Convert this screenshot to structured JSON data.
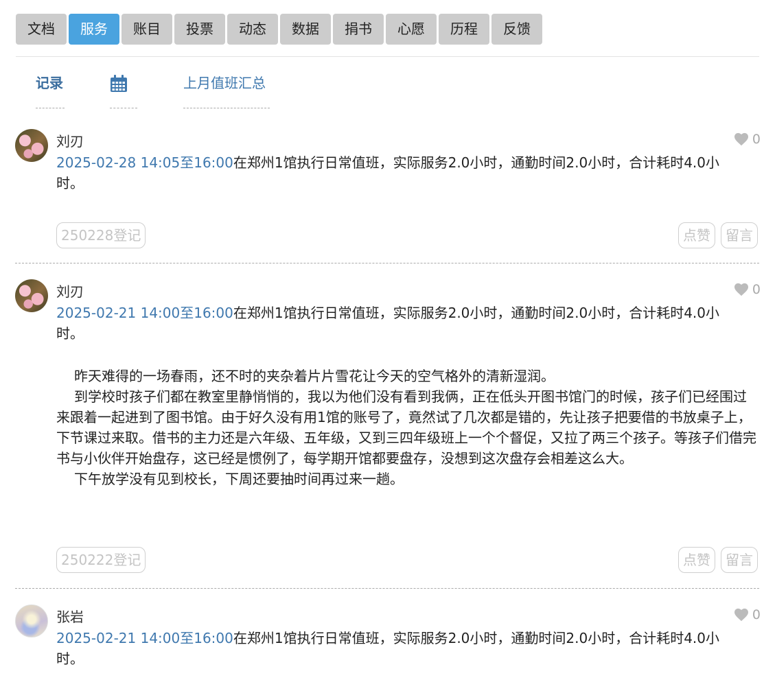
{
  "nav": {
    "items": [
      {
        "label": "文档"
      },
      {
        "label": "服务",
        "active": true
      },
      {
        "label": "账目"
      },
      {
        "label": "投票"
      },
      {
        "label": "动态"
      },
      {
        "label": "数据"
      },
      {
        "label": "捐书"
      },
      {
        "label": "心愿"
      },
      {
        "label": "历程"
      },
      {
        "label": "反馈"
      }
    ]
  },
  "subtabs": {
    "record": "记录",
    "calendar_icon": "calendar-icon",
    "summary": "上月值班汇总"
  },
  "colors": {
    "nav_active": "#4aa3df",
    "nav_default": "#cccccc",
    "link": "#3f78ae"
  },
  "posts": [
    {
      "author": "刘刃",
      "likes": "0",
      "when": "2025-02-28 14:05至16:00",
      "text": "在郑州1馆执行日常值班，实际服务2.0小时，通勤时间2.0小时，合计耗时4.0小时。",
      "tag": "250228登记",
      "like_btn": "点赞",
      "comment_btn": "留言"
    },
    {
      "author": "刘刃",
      "likes": "0",
      "when": "2025-02-21 14:00至16:00",
      "text": "在郑州1馆执行日常值班，实际服务2.0小时，通勤时间2.0小时，合计耗时4.0小时。",
      "paragraphs": [
        "昨天难得的一场春雨，还不时的夹杂着片片雪花让今天的空气格外的清新湿润。",
        "到学校时孩子们都在教室里静悄悄的，我以为他们没有看到我俩，正在低头开图书馆门的时候，孩子们已经围过来跟着一起进到了图书馆。由于好久没有用1馆的账号了，竟然试了几次都是错的，先让孩子把要借的书放桌子上，下节课过来取。借书的主力还是六年级、五年级，又到三四年级班上一个个督促，又拉了两三个孩子。等孩子们借完书与小伙伴开始盘存，这已经是惯例了，每学期开馆都要盘存，没想到这次盘存会相差这么大。",
        "下午放学没有见到校长，下周还要抽时间再过来一趟。"
      ],
      "tag": "250222登记",
      "like_btn": "点赞",
      "comment_btn": "留言"
    },
    {
      "author": "张岩",
      "likes": "0",
      "when": "2025-02-21 14:00至16:00",
      "text": "在郑州1馆执行日常值班，实际服务2.0小时，通勤时间2.0小时，合计耗时4.0小时。"
    }
  ]
}
